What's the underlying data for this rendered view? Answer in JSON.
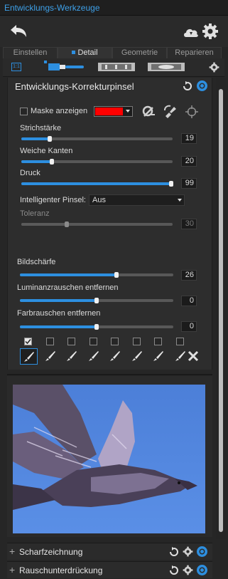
{
  "title": "Entwicklungs-Werkzeuge",
  "tabs": [
    {
      "label": "Einstellen",
      "active": false
    },
    {
      "label": "Detail",
      "active": true
    },
    {
      "label": "Geometrie",
      "active": false
    },
    {
      "label": "Reparieren",
      "active": false
    }
  ],
  "subtab_badge": "1:1",
  "panel": {
    "title": "Entwicklungs-Korrekturpinsel",
    "mask_label": "Maske anzeigen",
    "mask_color": "#ff0000",
    "sliders": [
      {
        "label": "Strichstärke",
        "value": "19",
        "fraction": 0.19
      },
      {
        "label": "Weiche Kanten",
        "value": "20",
        "fraction": 0.2
      },
      {
        "label": "Druck",
        "value": "99",
        "fraction": 0.99
      }
    ],
    "smart_brush_label": "Intelligenter Pinsel:",
    "smart_brush_value": "Aus",
    "tolerance": {
      "label": "Toleranz",
      "value": "30",
      "fraction": 0.3
    },
    "effects": [
      {
        "label": "Bildschärfe",
        "value": "26",
        "fraction": 0.63
      },
      {
        "label": "Luminanzrauschen entfernen",
        "value": "0",
        "fraction": 0.5
      },
      {
        "label": "Farbrauschen entfernen",
        "value": "0",
        "fraction": 0.5
      }
    ]
  },
  "sections": [
    {
      "label": "Scharfzeichnung"
    },
    {
      "label": "Rauschunterdrückung"
    }
  ],
  "colors": {
    "accent": "#2d8fe0",
    "title": "#3ea0e8"
  }
}
